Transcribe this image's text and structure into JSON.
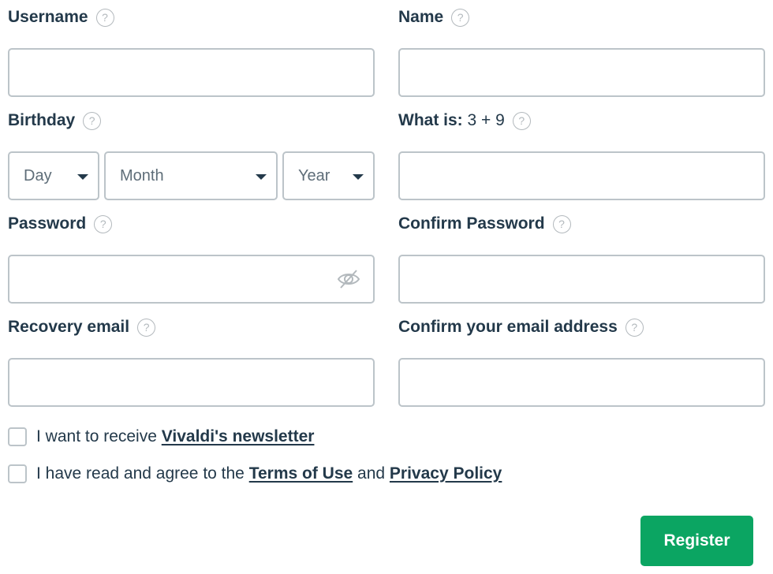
{
  "fields": {
    "username": {
      "label": "Username",
      "value": "",
      "placeholder": ""
    },
    "name": {
      "label": "Name",
      "value": "",
      "placeholder": ""
    },
    "birthday": {
      "label": "Birthday",
      "day": {
        "placeholder": "Day"
      },
      "month": {
        "placeholder": "Month"
      },
      "year": {
        "placeholder": "Year"
      }
    },
    "captcha": {
      "label": "What is:",
      "question": "3 + 9",
      "value": "",
      "placeholder": ""
    },
    "password": {
      "label": "Password",
      "value": "",
      "placeholder": "",
      "toggle_icon": "eye-slash-icon"
    },
    "confirm_password": {
      "label": "Confirm Password",
      "value": "",
      "placeholder": ""
    },
    "recovery_email": {
      "label": "Recovery email",
      "value": "",
      "placeholder": ""
    },
    "confirm_email": {
      "label": "Confirm your email address",
      "value": "",
      "placeholder": ""
    }
  },
  "help_icon": "?",
  "checkboxes": {
    "newsletter": {
      "text": "I want to receive ",
      "link": "Vivaldi's newsletter",
      "checked": false
    },
    "terms": {
      "text": "I have read and agree to the ",
      "link1": "Terms of Use",
      "middle": " and ",
      "link2": "Privacy Policy",
      "checked": false
    }
  },
  "register_button": "Register",
  "colors": {
    "primary_text": "#23394a",
    "accent_green": "#0ba562",
    "border": "#bcc4c9",
    "help_icon": "#b3b9bd"
  }
}
